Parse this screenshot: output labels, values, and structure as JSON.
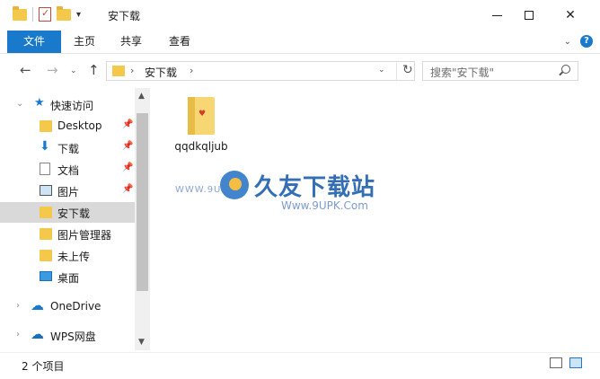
{
  "window": {
    "title": "安下载",
    "qat_dropdown": "▾"
  },
  "ribbon": {
    "tabs": [
      "文件",
      "主页",
      "共享",
      "查看"
    ]
  },
  "nav": {
    "back": "←",
    "forward": "→",
    "recent": "⌄",
    "up": "↑"
  },
  "address": {
    "path": "安下载",
    "sep": "›",
    "refresh": "↻"
  },
  "search": {
    "placeholder": "搜索\"安下载\""
  },
  "sidebar": {
    "items": [
      {
        "label": "快速访问",
        "icon": "star-icon"
      },
      {
        "label": "Desktop",
        "icon": "folder-icon",
        "pinned": true
      },
      {
        "label": "下载",
        "icon": "download-icon",
        "pinned": true
      },
      {
        "label": "文档",
        "icon": "document-icon",
        "pinned": true
      },
      {
        "label": "图片",
        "icon": "picture-icon",
        "pinned": true
      },
      {
        "label": "安下载",
        "icon": "folder-icon",
        "selected": true
      },
      {
        "label": "图片管理器",
        "icon": "folder-icon"
      },
      {
        "label": "未上传",
        "icon": "folder-icon"
      },
      {
        "label": "桌面",
        "icon": "desktop-icon"
      },
      {
        "label": "OneDrive",
        "icon": "cloud-icon"
      },
      {
        "label": "WPS网盘",
        "icon": "wps-cloud-icon"
      }
    ]
  },
  "content": {
    "files": [
      {
        "name": "qqdkqljub",
        "icon": "folder-icon"
      }
    ]
  },
  "watermark": {
    "title": "久友下载站",
    "url": "Www.9UPK.Com",
    "left_text": "WWW.9U"
  },
  "status": {
    "count": "2 个项目"
  },
  "colors": {
    "accent": "#1979ca",
    "folder": "#f4c84a",
    "selected": "#d9d9d9"
  }
}
